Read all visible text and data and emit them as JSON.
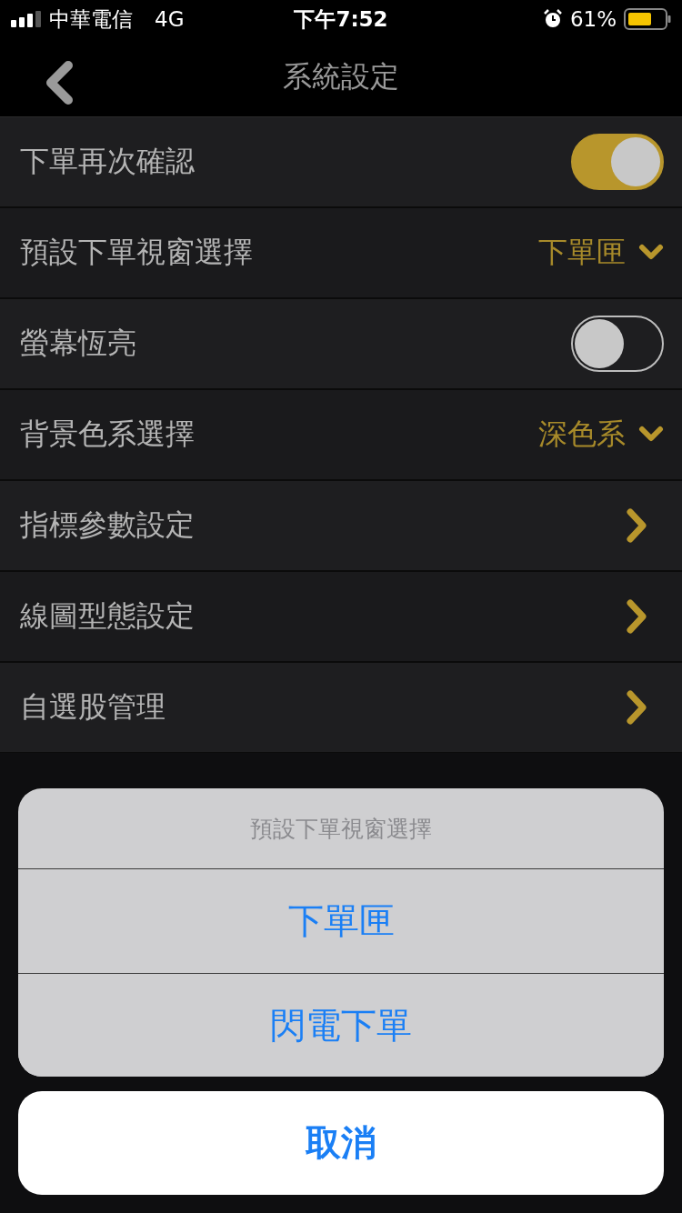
{
  "status_bar": {
    "carrier": "中華電信",
    "network": "4G",
    "time": "下午7:52",
    "battery": "61%"
  },
  "nav": {
    "title": "系統設定"
  },
  "settings": [
    {
      "kind": "toggle",
      "label": "下單再次確認",
      "on": true
    },
    {
      "kind": "select",
      "label": "預設下單視窗選擇",
      "value": "下單匣"
    },
    {
      "kind": "toggle",
      "label": "螢幕恆亮",
      "on": false
    },
    {
      "kind": "select",
      "label": "背景色系選擇",
      "value": "深色系"
    },
    {
      "kind": "link",
      "label": "指標參數設定"
    },
    {
      "kind": "link",
      "label": "線圖型態設定"
    },
    {
      "kind": "link",
      "label": "自選股管理"
    }
  ],
  "action_sheet": {
    "title": "預設下單視窗選擇",
    "options": [
      "下單匣",
      "閃電下單"
    ],
    "cancel": "取消"
  }
}
